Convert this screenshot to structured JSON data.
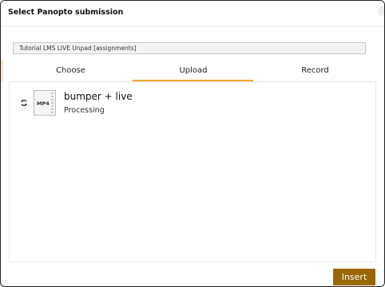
{
  "dialog": {
    "title": "Select Panopto submission"
  },
  "folder": {
    "name": "Tutorial LMS LIVE Unpad  [assignments]"
  },
  "tabs": [
    {
      "label": "Choose"
    },
    {
      "label": "Upload"
    },
    {
      "label": "Record"
    }
  ],
  "active_tab": "Upload",
  "upload_item": {
    "file_type": "MP4",
    "name": "bumper + live",
    "status": "Processing",
    "status_icon": "sync-icon",
    "file_icon": "video-file-icon"
  },
  "footer": {
    "insert_label": "Insert"
  },
  "colors": {
    "accent": "#f0a72a",
    "button": "#9a6607"
  }
}
